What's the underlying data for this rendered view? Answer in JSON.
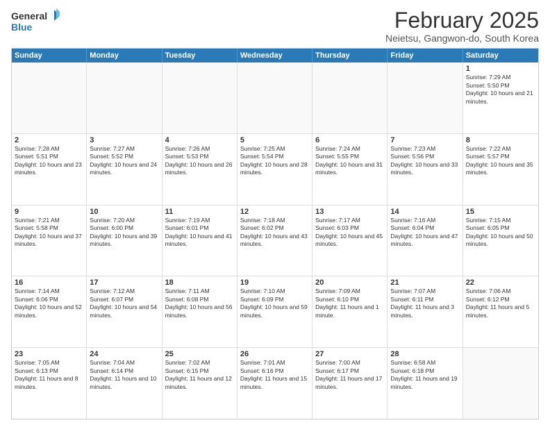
{
  "header": {
    "logo_general": "General",
    "logo_blue": "Blue",
    "main_title": "February 2025",
    "subtitle": "Neietsu, Gangwon-do, South Korea"
  },
  "days": [
    "Sunday",
    "Monday",
    "Tuesday",
    "Wednesday",
    "Thursday",
    "Friday",
    "Saturday"
  ],
  "weeks": [
    [
      {
        "day": "",
        "text": ""
      },
      {
        "day": "",
        "text": ""
      },
      {
        "day": "",
        "text": ""
      },
      {
        "day": "",
        "text": ""
      },
      {
        "day": "",
        "text": ""
      },
      {
        "day": "",
        "text": ""
      },
      {
        "day": "1",
        "text": "Sunrise: 7:29 AM\nSunset: 5:50 PM\nDaylight: 10 hours and 21 minutes."
      }
    ],
    [
      {
        "day": "2",
        "text": "Sunrise: 7:28 AM\nSunset: 5:51 PM\nDaylight: 10 hours and 23 minutes."
      },
      {
        "day": "3",
        "text": "Sunrise: 7:27 AM\nSunset: 5:52 PM\nDaylight: 10 hours and 24 minutes."
      },
      {
        "day": "4",
        "text": "Sunrise: 7:26 AM\nSunset: 5:53 PM\nDaylight: 10 hours and 26 minutes."
      },
      {
        "day": "5",
        "text": "Sunrise: 7:25 AM\nSunset: 5:54 PM\nDaylight: 10 hours and 28 minutes."
      },
      {
        "day": "6",
        "text": "Sunrise: 7:24 AM\nSunset: 5:55 PM\nDaylight: 10 hours and 31 minutes."
      },
      {
        "day": "7",
        "text": "Sunrise: 7:23 AM\nSunset: 5:56 PM\nDaylight: 10 hours and 33 minutes."
      },
      {
        "day": "8",
        "text": "Sunrise: 7:22 AM\nSunset: 5:57 PM\nDaylight: 10 hours and 35 minutes."
      }
    ],
    [
      {
        "day": "9",
        "text": "Sunrise: 7:21 AM\nSunset: 5:58 PM\nDaylight: 10 hours and 37 minutes."
      },
      {
        "day": "10",
        "text": "Sunrise: 7:20 AM\nSunset: 6:00 PM\nDaylight: 10 hours and 39 minutes."
      },
      {
        "day": "11",
        "text": "Sunrise: 7:19 AM\nSunset: 6:01 PM\nDaylight: 10 hours and 41 minutes."
      },
      {
        "day": "12",
        "text": "Sunrise: 7:18 AM\nSunset: 6:02 PM\nDaylight: 10 hours and 43 minutes."
      },
      {
        "day": "13",
        "text": "Sunrise: 7:17 AM\nSunset: 6:03 PM\nDaylight: 10 hours and 45 minutes."
      },
      {
        "day": "14",
        "text": "Sunrise: 7:16 AM\nSunset: 6:04 PM\nDaylight: 10 hours and 47 minutes."
      },
      {
        "day": "15",
        "text": "Sunrise: 7:15 AM\nSunset: 6:05 PM\nDaylight: 10 hours and 50 minutes."
      }
    ],
    [
      {
        "day": "16",
        "text": "Sunrise: 7:14 AM\nSunset: 6:06 PM\nDaylight: 10 hours and 52 minutes."
      },
      {
        "day": "17",
        "text": "Sunrise: 7:12 AM\nSunset: 6:07 PM\nDaylight: 10 hours and 54 minutes."
      },
      {
        "day": "18",
        "text": "Sunrise: 7:11 AM\nSunset: 6:08 PM\nDaylight: 10 hours and 56 minutes."
      },
      {
        "day": "19",
        "text": "Sunrise: 7:10 AM\nSunset: 6:09 PM\nDaylight: 10 hours and 59 minutes."
      },
      {
        "day": "20",
        "text": "Sunrise: 7:09 AM\nSunset: 6:10 PM\nDaylight: 11 hours and 1 minute."
      },
      {
        "day": "21",
        "text": "Sunrise: 7:07 AM\nSunset: 6:11 PM\nDaylight: 11 hours and 3 minutes."
      },
      {
        "day": "22",
        "text": "Sunrise: 7:06 AM\nSunset: 6:12 PM\nDaylight: 11 hours and 5 minutes."
      }
    ],
    [
      {
        "day": "23",
        "text": "Sunrise: 7:05 AM\nSunset: 6:13 PM\nDaylight: 11 hours and 8 minutes."
      },
      {
        "day": "24",
        "text": "Sunrise: 7:04 AM\nSunset: 6:14 PM\nDaylight: 11 hours and 10 minutes."
      },
      {
        "day": "25",
        "text": "Sunrise: 7:02 AM\nSunset: 6:15 PM\nDaylight: 11 hours and 12 minutes."
      },
      {
        "day": "26",
        "text": "Sunrise: 7:01 AM\nSunset: 6:16 PM\nDaylight: 11 hours and 15 minutes."
      },
      {
        "day": "27",
        "text": "Sunrise: 7:00 AM\nSunset: 6:17 PM\nDaylight: 11 hours and 17 minutes."
      },
      {
        "day": "28",
        "text": "Sunrise: 6:58 AM\nSunset: 6:18 PM\nDaylight: 11 hours and 19 minutes."
      },
      {
        "day": "",
        "text": ""
      }
    ]
  ]
}
